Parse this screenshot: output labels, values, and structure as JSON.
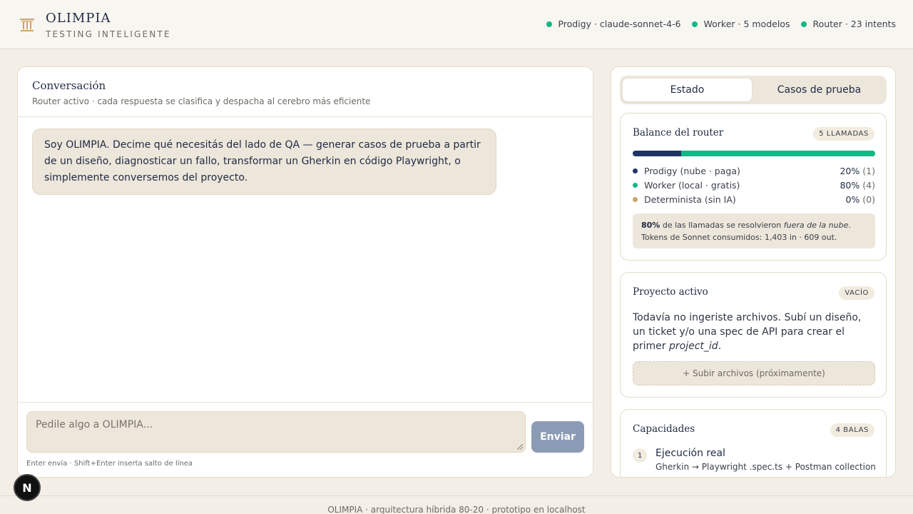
{
  "header": {
    "brand_name": "OLIMPIA",
    "brand_tagline": "TESTING INTELIGENTE",
    "logo_icon": "temple-icon",
    "status": [
      {
        "label": "Prodigy · claude-sonnet-4-6",
        "color": "#12b886"
      },
      {
        "label": "Worker · 5 modelos",
        "color": "#12b886"
      },
      {
        "label": "Router · 23 intents",
        "color": "#12b886"
      }
    ]
  },
  "conversation": {
    "title": "Conversación",
    "subtitle": "Router activo · cada respuesta se clasifica y despacha al cerebro más eficiente",
    "messages": [
      {
        "role": "assistant",
        "text": "Soy OLIMPIA. Decime qué necesitás del lado de QA — generar casos de prueba a partir de un diseño, diagnosticar un fallo, transformar un Gherkin en código Playwright, o simplemente conversemos del proyecto."
      }
    ],
    "input_placeholder": "Pedile algo a OLIMPIA...",
    "send_label": "Enviar",
    "hint": "Enter envía · Shift+Enter inserta salto de línea"
  },
  "sidebar": {
    "tabs": [
      {
        "label": "Estado",
        "active": true
      },
      {
        "label": "Casos de prueba",
        "active": false
      }
    ],
    "router_balance": {
      "title": "Balance del router",
      "badge": "5 LLAMADAS",
      "rows": [
        {
          "label": "Prodigy (nube · paga)",
          "percent": "20%",
          "count": "(1)",
          "color": "#1f3566",
          "fraction": 0.2
        },
        {
          "label": "Worker (local · gratis)",
          "percent": "80%",
          "count": "(4)",
          "color": "#12b886",
          "fraction": 0.8
        },
        {
          "label": "Determinista (sin IA)",
          "percent": "0%",
          "count": "(0)",
          "color": "#c9a36a",
          "fraction": 0.0
        }
      ],
      "note_strong": "80%",
      "note_text": " de las llamadas se resolvieron ",
      "note_em": "fuera de la nube",
      "note_end": ".",
      "tokens": "Tokens de Sonnet consumidos: 1,403 in · 609 out."
    },
    "project": {
      "title": "Proyecto activo",
      "badge": "VACÍO",
      "text": "Todavía no ingeriste archivos. Subí un diseño, un ticket y/o una spec de API para crear el primer ",
      "text_em": "project_id",
      "text_end": ".",
      "upload_label": "+ Subir archivos (próximamente)"
    },
    "capabilities": {
      "title": "Capacidades",
      "badge": "4 BALAS",
      "items": [
        {
          "number": "1",
          "title": "Ejecución real",
          "desc": "Gherkin → Playwright .spec.ts + Postman collection"
        }
      ]
    }
  },
  "footer": {
    "text": "OLIMPIA · arquitectura híbrida 80-20 · prototipo en localhost"
  },
  "dev_badge": "N"
}
